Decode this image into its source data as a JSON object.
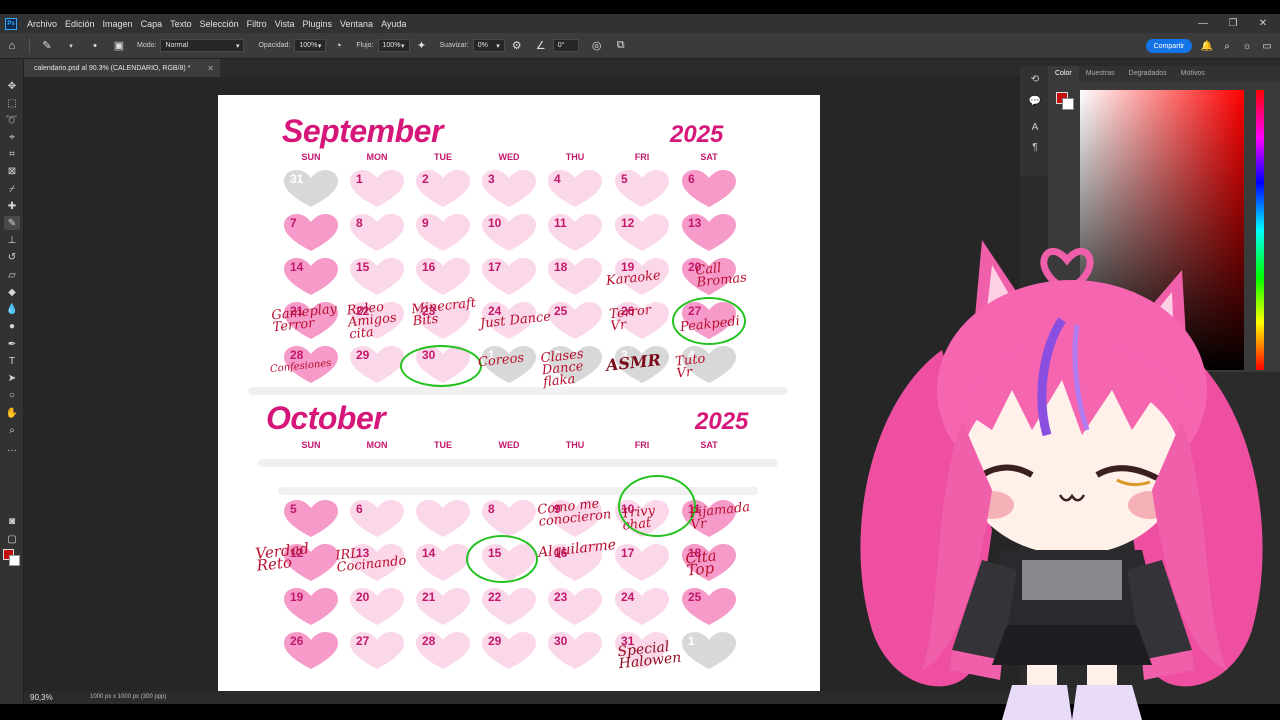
{
  "app": {
    "logo": "Ps",
    "menu": [
      "Archivo",
      "Edición",
      "Imagen",
      "Capa",
      "Texto",
      "Selección",
      "Filtro",
      "Vista",
      "Plugins",
      "Ventana",
      "Ayuda"
    ]
  },
  "options": {
    "mode_label": "Modo:",
    "mode_value": "Normal",
    "opacity_label": "Opacidad:",
    "opacity_value": "100%",
    "flow_label": "Flujo:",
    "flow_value": "100%",
    "smooth_label": "Suavizar:",
    "smooth_value": "0%",
    "angle_value": "0°",
    "share_label": "Compartir"
  },
  "document": {
    "tab_title": "calendario.psd al 90.3% (CALENDARIO, RGB/8) *",
    "zoom": "90,3%",
    "size_info": "1000 px x 1000 px (300 ppp)"
  },
  "panel": {
    "tabs": [
      "Color",
      "Muestras",
      "Degradados",
      "Motivos"
    ],
    "active_tab": "Color"
  },
  "colors": {
    "foreground": "#c40d0d",
    "background": "#ffffff",
    "accent": "#1473e6",
    "calendar_pink": "#d6177a"
  },
  "calendar": {
    "days": [
      "SUN",
      "MON",
      "TUE",
      "WED",
      "THU",
      "FRI",
      "SAT"
    ],
    "september": {
      "title": "September",
      "year": "2025",
      "cells": [
        "31",
        "1",
        "2",
        "3",
        "4",
        "5",
        "6",
        "7",
        "8",
        "9",
        "10",
        "11",
        "12",
        "13",
        "14",
        "15",
        "16",
        "17",
        "18",
        "19",
        "20",
        "21",
        "22",
        "23",
        "24",
        "25",
        "26",
        "27",
        "28",
        "29",
        "30",
        "1",
        "2",
        "3",
        "4"
      ]
    },
    "october": {
      "title": "October",
      "year": "2025",
      "day_labels": [
        "SUN",
        "MON",
        "TUE",
        "WED",
        "THU",
        "FRI",
        "SAT"
      ],
      "cells": [
        "5",
        "6",
        "",
        "8",
        "9",
        "10",
        "11",
        "12",
        "13",
        "14",
        "15",
        "16",
        "17",
        "18",
        "19",
        "20",
        "21",
        "22",
        "23",
        "24",
        "25",
        "26",
        "27",
        "28",
        "29",
        "30",
        "31",
        "1"
      ]
    },
    "notes": {
      "sep_19": "Karaoke",
      "sep_20": "Call\nBromas",
      "sep_21": "Gameplay\nTerror",
      "sep_22": "Roleo\nAmigos\ncita",
      "sep_23": "Minecraft\nBits",
      "sep_24": "Just Dance",
      "sep_26": "Terror\nVr",
      "sep_27": "Peakpedi",
      "sep_28": "Confesiones",
      "oct_1": "Coreos",
      "oct_2": "Clases\nDance\nflaka",
      "oct_3": "ASMR",
      "oct_4": "Tuto\nVr",
      "oct_9": "Como me\nconocieron",
      "oct_10": "Trivy\nchat",
      "oct_11": "Pijamada\nVr",
      "oct_12": "Verdad\nReto",
      "oct_13": "IRL\nCocinando",
      "oct_16": "Alquilarme",
      "oct_18": "Cita\nTop",
      "oct_31": "Special\nHalowen"
    }
  }
}
